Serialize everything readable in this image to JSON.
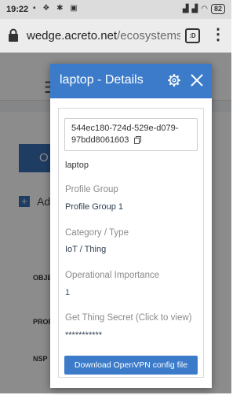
{
  "status_bar": {
    "time": "19:22",
    "left_icons": [
      "notification-icon",
      "dropbox-icon",
      "bug-icon",
      "lock-icon"
    ],
    "right_icons": [
      "signal-icon",
      "signal-icon",
      "wifi-icon",
      "battery-icon"
    ],
    "battery": "82"
  },
  "browser": {
    "url_host": "wedge.acreto.net",
    "url_path": "/ecosystems,",
    "tabs_count": ":D"
  },
  "background": {
    "button_text": "O",
    "add_text": "Ad",
    "row_labels": [
      "OBJE",
      "PROF",
      "NSP"
    ]
  },
  "modal": {
    "title": "laptop - Details",
    "id": "544ec180-724d-529e-d079-97bdd8061603",
    "name": "laptop",
    "profile_group_label": "Profile Group",
    "profile_group_value": "Profile Group 1",
    "category_label": "Category / Type",
    "category_value": "IoT / Thing",
    "importance_label": "Operational Importance",
    "importance_value": "1",
    "secret_label": "Get Thing Secret (Click to view)",
    "secret_value": "***********",
    "download_button": "Download OpenVPN config file"
  },
  "colors": {
    "header_blue": "#3b7bc9",
    "button_blue": "#3b7bc9",
    "page_blue": "#3a6fb5"
  }
}
